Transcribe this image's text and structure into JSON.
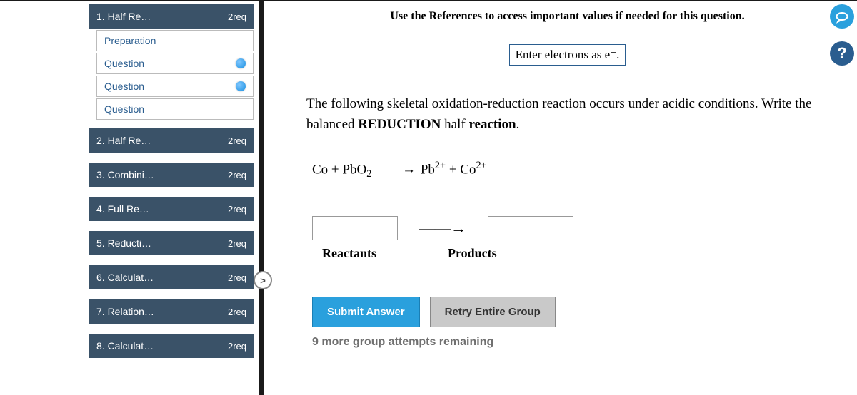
{
  "sidebar": {
    "items": [
      {
        "label": "1. Half Re…",
        "req": "2req"
      },
      {
        "label": "2. Half Re…",
        "req": "2req"
      },
      {
        "label": "3. Combini…",
        "req": "2req"
      },
      {
        "label": "4. Full Re…",
        "req": "2req"
      },
      {
        "label": "5. Reducti…",
        "req": "2req"
      },
      {
        "label": "6. Calculat…",
        "req": "2req"
      },
      {
        "label": "7. Relation…",
        "req": "2req"
      },
      {
        "label": "8. Calculat…",
        "req": "2req"
      }
    ],
    "sub_items": [
      {
        "label": "Preparation"
      },
      {
        "label": "Question"
      },
      {
        "label": "Question"
      },
      {
        "label": "Question"
      }
    ]
  },
  "content": {
    "references_text": "Use the References to access important values if needed for this question.",
    "hint": "Enter electrons as e⁻.",
    "question_pre": "The following skeletal oxidation-reduction reaction occurs under acidic conditions. Write the balanced ",
    "question_bold": "REDUCTION",
    "question_post": " half reaction.",
    "reactants_label": "Reactants",
    "products_label": "Products",
    "equation": {
      "lhs_1": "Co + PbO",
      "lhs_sub": "2",
      "rhs_1": "Pb",
      "rhs_1_sup": "2+",
      "rhs_plus": " + Co",
      "rhs_2_sup": "2+"
    },
    "submit_label": "Submit Answer",
    "retry_label": "Retry Entire Group",
    "attempts_text": "9 more group attempts remaining"
  },
  "collapse_glyph": ">"
}
